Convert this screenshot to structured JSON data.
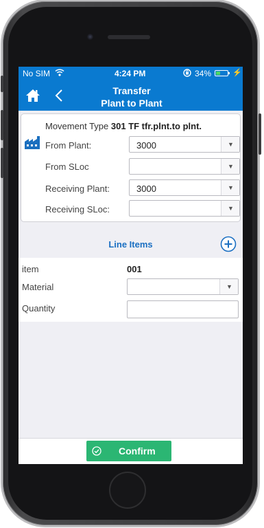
{
  "status_bar": {
    "carrier": "No SIM",
    "time": "4:24 PM",
    "battery": "34%",
    "battery_level": 0.34
  },
  "nav": {
    "title_line1": "Transfer",
    "title_line2": "Plant to Plant"
  },
  "header": {
    "movement_type_label": "Movement Type",
    "movement_type_value": "301 TF tfr.plnt.to plnt.",
    "fields": [
      {
        "label": "From Plant:",
        "value": "3000"
      },
      {
        "label": "From SLoc",
        "value": ""
      },
      {
        "label": "Receiving Plant:",
        "value": "3000"
      },
      {
        "label": "Receiving SLoc:",
        "value": ""
      }
    ]
  },
  "line_items": {
    "title": "Line Items",
    "item_label": "item",
    "item_value": "001",
    "material_label": "Material",
    "material_value": "",
    "quantity_label": "Quantity",
    "quantity_value": ""
  },
  "footer": {
    "confirm_label": "Confirm"
  },
  "colors": {
    "brand": "#0a7ad0",
    "confirm": "#2bb673",
    "accent_text": "#1a6fc2"
  }
}
